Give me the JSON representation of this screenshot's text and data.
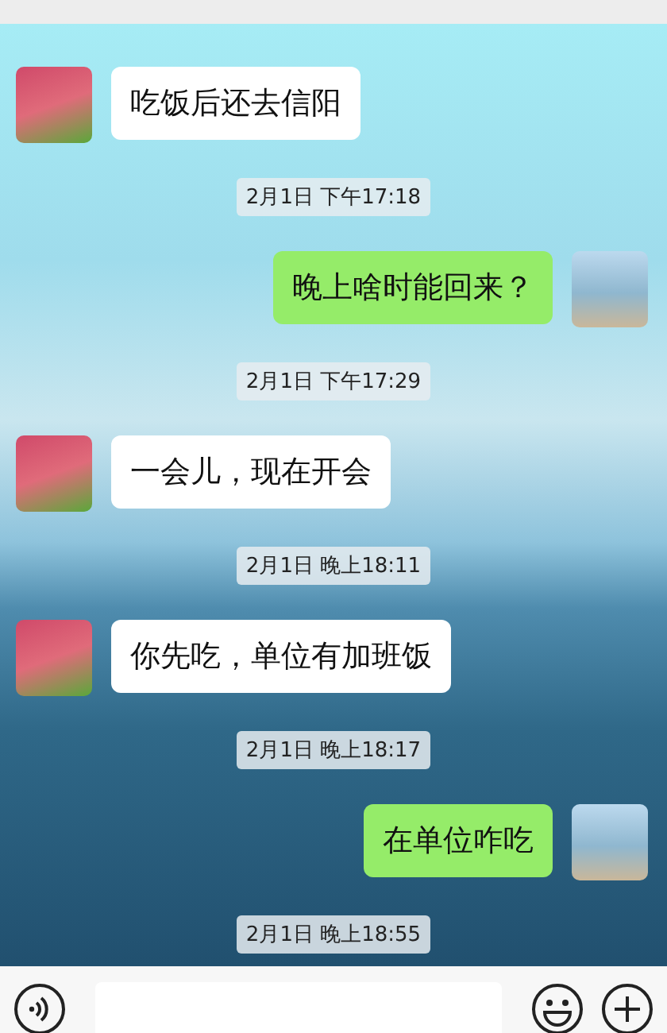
{
  "messages": [
    {
      "kind": "received",
      "text": "吃饭后还去信阳"
    },
    {
      "kind": "time",
      "text": "2月1日 下午17:18"
    },
    {
      "kind": "sent",
      "text": "晚上啥时能回来？"
    },
    {
      "kind": "time",
      "text": "2月1日 下午17:29"
    },
    {
      "kind": "received",
      "text": "一会儿，现在开会"
    },
    {
      "kind": "time",
      "text": "2月1日 晚上18:11"
    },
    {
      "kind": "received",
      "text": "你先吃，单位有加班饭"
    },
    {
      "kind": "time",
      "text": "2月1日 晚上18:17"
    },
    {
      "kind": "sent",
      "text": "在单位咋吃"
    },
    {
      "kind": "time",
      "text": "2月1日 晚上18:55"
    }
  ]
}
